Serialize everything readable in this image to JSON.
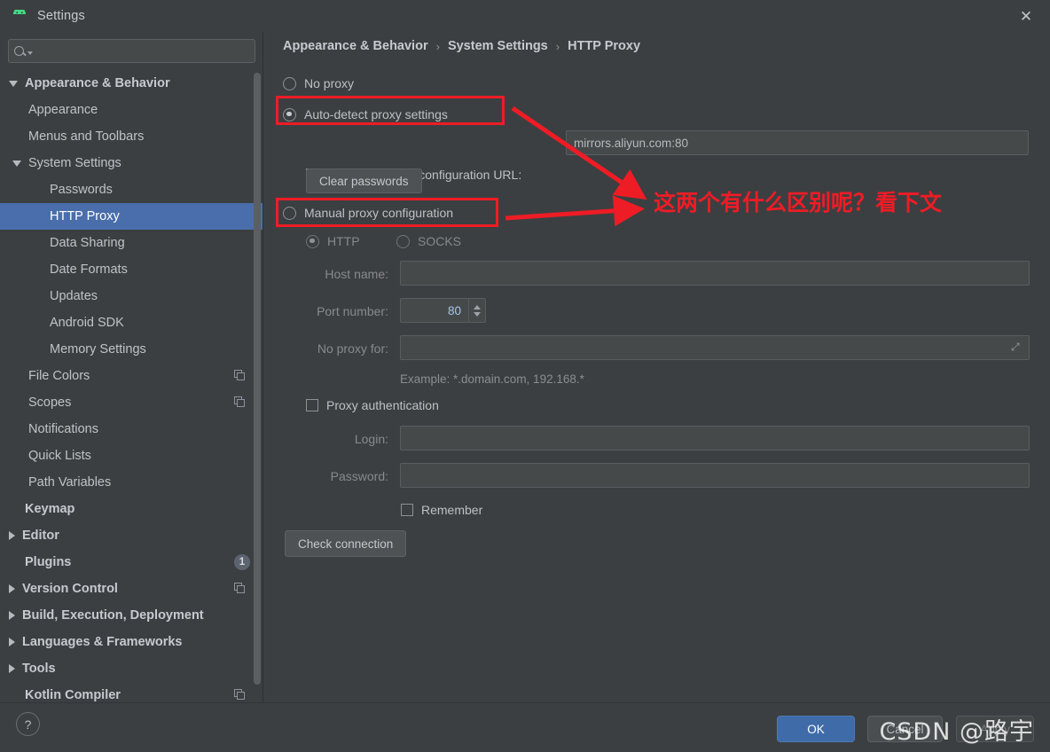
{
  "window": {
    "title": "Settings",
    "app_icon": "android-robot-icon",
    "close_label": "✕",
    "accent_selected": "#4a6eab",
    "background": "#3c3f41",
    "annotation_color": "#ee1c25"
  },
  "sidebar": {
    "search": {
      "value": "",
      "placeholder": "",
      "icon": "search-icon"
    },
    "items": [
      {
        "label": "Appearance & Behavior",
        "indent": 0,
        "twisty": "down",
        "bold": true,
        "selected": false,
        "badge": null,
        "copy": false
      },
      {
        "label": "Appearance",
        "indent": 1,
        "twisty": "none",
        "bold": false,
        "selected": false,
        "badge": null,
        "copy": false
      },
      {
        "label": "Menus and Toolbars",
        "indent": 1,
        "twisty": "none",
        "bold": false,
        "selected": false,
        "badge": null,
        "copy": false
      },
      {
        "label": "System Settings",
        "indent": 1,
        "twisty": "down",
        "bold": false,
        "selected": false,
        "badge": null,
        "copy": false
      },
      {
        "label": "Passwords",
        "indent": 2,
        "twisty": "none",
        "bold": false,
        "selected": false,
        "badge": null,
        "copy": false
      },
      {
        "label": "HTTP Proxy",
        "indent": 2,
        "twisty": "none",
        "bold": false,
        "selected": true,
        "badge": null,
        "copy": false
      },
      {
        "label": "Data Sharing",
        "indent": 2,
        "twisty": "none",
        "bold": false,
        "selected": false,
        "badge": null,
        "copy": false
      },
      {
        "label": "Date Formats",
        "indent": 2,
        "twisty": "none",
        "bold": false,
        "selected": false,
        "badge": null,
        "copy": false
      },
      {
        "label": "Updates",
        "indent": 2,
        "twisty": "none",
        "bold": false,
        "selected": false,
        "badge": null,
        "copy": false
      },
      {
        "label": "Android SDK",
        "indent": 2,
        "twisty": "none",
        "bold": false,
        "selected": false,
        "badge": null,
        "copy": false
      },
      {
        "label": "Memory Settings",
        "indent": 2,
        "twisty": "none",
        "bold": false,
        "selected": false,
        "badge": null,
        "copy": false
      },
      {
        "label": "File Colors",
        "indent": 1,
        "twisty": "none",
        "bold": false,
        "selected": false,
        "badge": null,
        "copy": true
      },
      {
        "label": "Scopes",
        "indent": 1,
        "twisty": "none",
        "bold": false,
        "selected": false,
        "badge": null,
        "copy": true
      },
      {
        "label": "Notifications",
        "indent": 1,
        "twisty": "none",
        "bold": false,
        "selected": false,
        "badge": null,
        "copy": false
      },
      {
        "label": "Quick Lists",
        "indent": 1,
        "twisty": "none",
        "bold": false,
        "selected": false,
        "badge": null,
        "copy": false
      },
      {
        "label": "Path Variables",
        "indent": 1,
        "twisty": "none",
        "bold": false,
        "selected": false,
        "badge": null,
        "copy": false
      },
      {
        "label": "Keymap",
        "indent": 0,
        "twisty": "none",
        "bold": true,
        "selected": false,
        "badge": null,
        "copy": false
      },
      {
        "label": "Editor",
        "indent": 0,
        "twisty": "right",
        "bold": true,
        "selected": false,
        "badge": null,
        "copy": false
      },
      {
        "label": "Plugins",
        "indent": 0,
        "twisty": "none",
        "bold": true,
        "selected": false,
        "badge": "1",
        "copy": false
      },
      {
        "label": "Version Control",
        "indent": 0,
        "twisty": "right",
        "bold": true,
        "selected": false,
        "badge": null,
        "copy": true
      },
      {
        "label": "Build, Execution, Deployment",
        "indent": 0,
        "twisty": "right",
        "bold": true,
        "selected": false,
        "badge": null,
        "copy": false
      },
      {
        "label": "Languages & Frameworks",
        "indent": 0,
        "twisty": "right",
        "bold": true,
        "selected": false,
        "badge": null,
        "copy": false
      },
      {
        "label": "Tools",
        "indent": 0,
        "twisty": "right",
        "bold": true,
        "selected": false,
        "badge": null,
        "copy": false
      },
      {
        "label": "Kotlin Compiler",
        "indent": 0,
        "twisty": "none",
        "bold": true,
        "selected": false,
        "badge": null,
        "copy": true
      }
    ]
  },
  "breadcrumb": {
    "part1": "Appearance & Behavior",
    "sep1": "›",
    "part2": "System Settings",
    "sep2": "›",
    "part3": "HTTP Proxy"
  },
  "proxy": {
    "no_proxy_label": "No proxy",
    "auto_detect_label": "Auto-detect proxy settings",
    "auto_config_url_label": "Automatic proxy configuration URL:",
    "auto_config_url_value": "mirrors.aliyun.com:80",
    "clear_passwords_label": "Clear passwords",
    "manual_label": "Manual proxy configuration",
    "http_label": "HTTP",
    "socks_label": "SOCKS",
    "host_name_label": "Host name:",
    "host_name_value": "",
    "port_number_label": "Port number:",
    "port_number_value": "80",
    "no_proxy_for_label": "No proxy for:",
    "no_proxy_for_value": "",
    "example_hint": "Example: *.domain.com, 192.168.*",
    "proxy_auth_label": "Proxy authentication",
    "login_label": "Login:",
    "login_value": "",
    "password_label": "Password:",
    "password_value": "",
    "remember_label": "Remember",
    "check_connection_label": "Check connection",
    "selected_mode": "auto-detect",
    "protocol_selected": "HTTP",
    "auto_config_url_checked": true,
    "proxy_auth_checked": false,
    "remember_checked": false
  },
  "footer": {
    "help_label": "?",
    "ok_label": "OK",
    "cancel_label": "Cancel",
    "apply_label": "Apply"
  },
  "annotation": {
    "note_text": "这两个有什么区别呢？看下文",
    "watermark": "CSDN @路宇"
  }
}
